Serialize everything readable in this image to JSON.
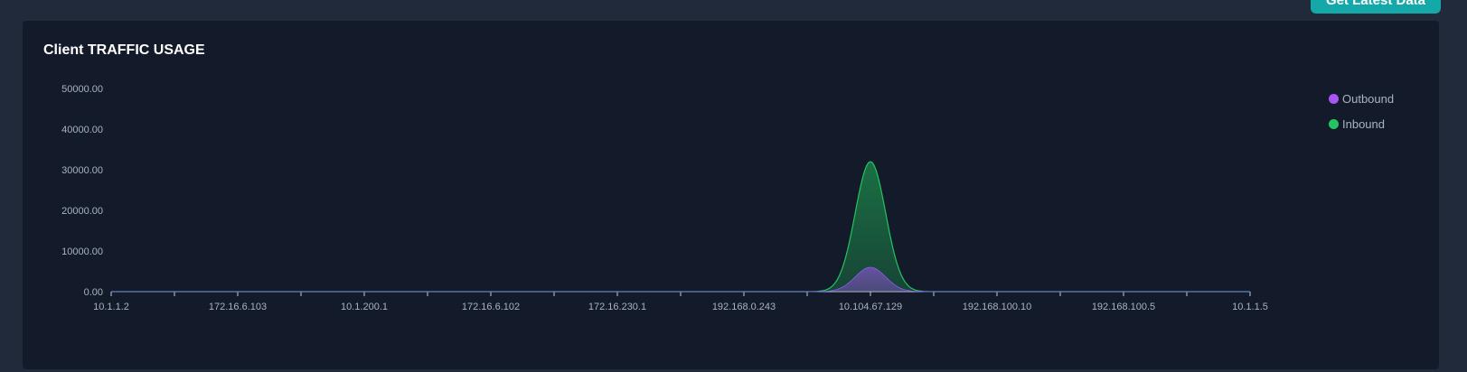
{
  "header": {
    "button_label": "Get Latest Data"
  },
  "chart_data": {
    "type": "area",
    "title": "Client TRAFFIC USAGE",
    "xlabel": "",
    "ylabel": "",
    "ylim": [
      0,
      50000
    ],
    "yticks": [
      "0.00",
      "10000.00",
      "20000.00",
      "30000.00",
      "40000.00",
      "50000.00"
    ],
    "categories": [
      "10.1.1.2",
      "172.16.6.103",
      "10.1.200.1",
      "172.16.6.102",
      "172.16.230.1",
      "192.168.0.243",
      "10.104.67.129",
      "192.168.100.10",
      "192.168.100.5",
      "10.1.1.5"
    ],
    "series": [
      {
        "name": "Outbound",
        "color": "#a855f7",
        "values": [
          0,
          0,
          0,
          0,
          0,
          0,
          6000,
          0,
          0,
          0
        ]
      },
      {
        "name": "Inbound",
        "color": "#22c55e",
        "values": [
          0,
          0,
          0,
          0,
          0,
          0,
          32000,
          0,
          0,
          0
        ]
      }
    ],
    "legend_position": "top-right",
    "grid": false
  }
}
